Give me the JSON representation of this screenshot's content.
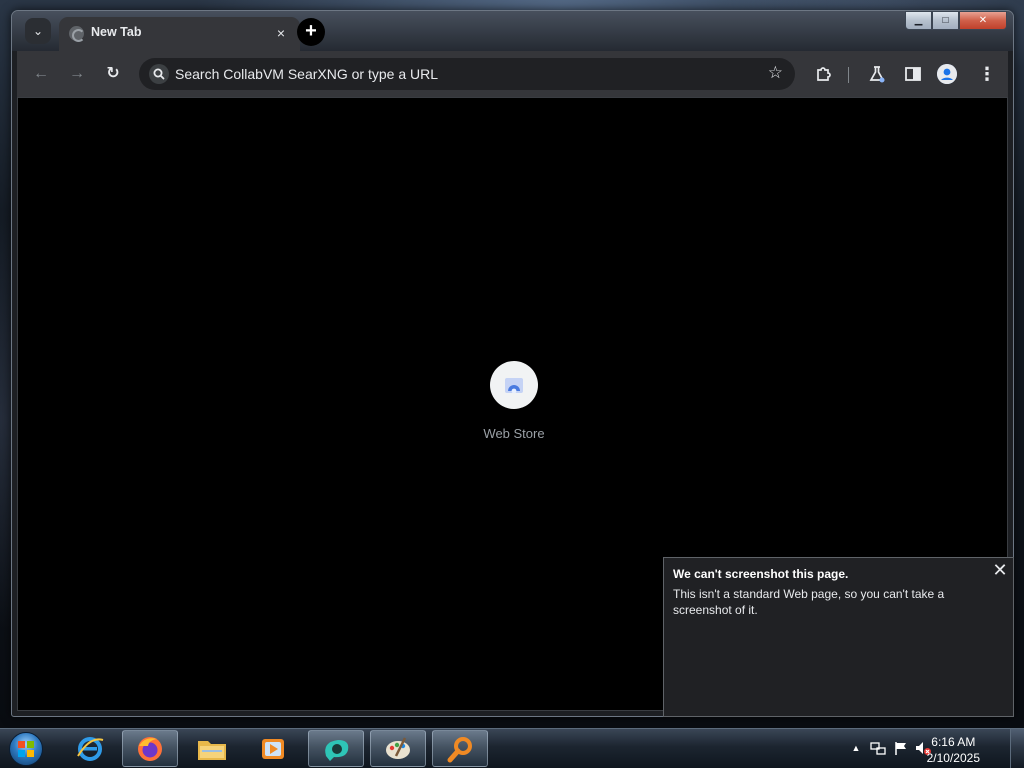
{
  "browser": {
    "tab": {
      "title": "New Tab",
      "close_glyph": "×"
    },
    "new_tab_glyph": "+",
    "tab_search_glyph": "⌄",
    "window_controls": {
      "minimize": "▁",
      "maximize": "□",
      "close": "✕"
    },
    "toolbar": {
      "back_glyph": "←",
      "forward_glyph": "→",
      "reload_glyph": "↻",
      "omnibox_placeholder": "Search CollabVM SearXNG or type a URL",
      "bookmark_glyph": "☆",
      "menu_glyph": "⋮"
    },
    "ntp": {
      "shortcut_label": "Web Store"
    }
  },
  "notification": {
    "title": "We can't screenshot this page.",
    "body": "This isn't a standard Web page, so you can't take a screenshot of it.",
    "close_glyph": "✕"
  },
  "taskbar": {
    "apps": [
      {
        "name": "internet-explorer-icon"
      },
      {
        "name": "firefox-icon"
      },
      {
        "name": "file-explorer-icon"
      },
      {
        "name": "media-player-icon"
      },
      {
        "name": "chrome-icon",
        "active": true
      },
      {
        "name": "paint-icon"
      },
      {
        "name": "search-app-icon"
      }
    ],
    "clock": {
      "time": "6:16 AM",
      "date": "2/10/2025"
    },
    "tray_arrow": "▲"
  },
  "colors": {
    "toolbar": "#35363a",
    "omnibox": "#202124",
    "content": "#000000",
    "accent": "#8ab4f8"
  }
}
